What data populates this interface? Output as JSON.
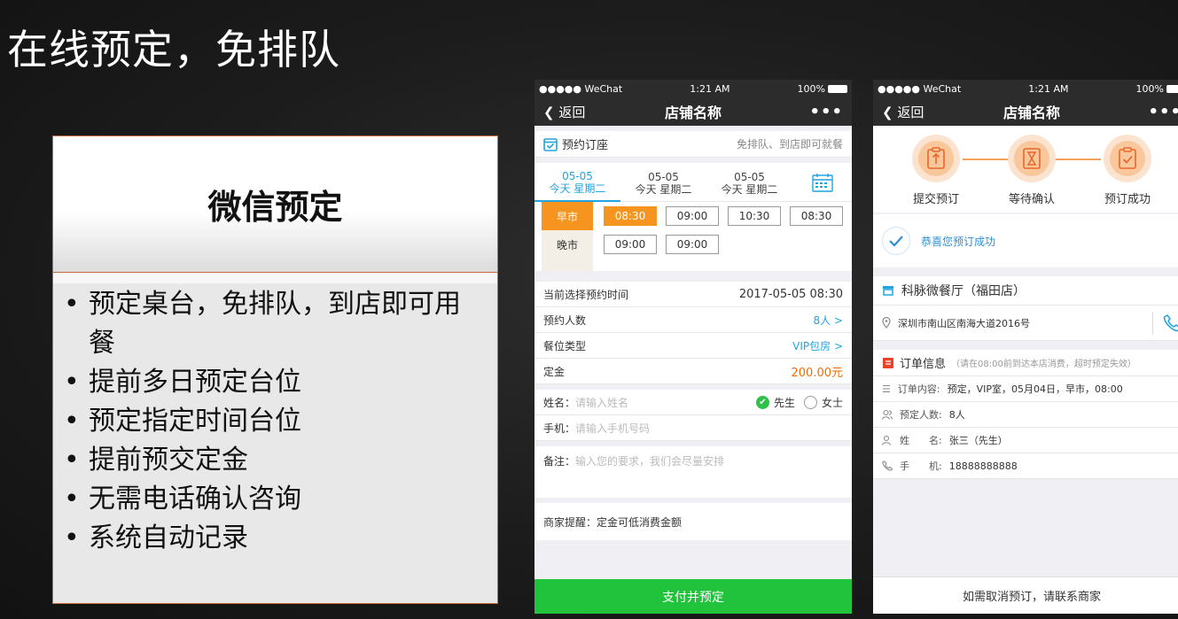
{
  "slide": {
    "title": "在线预定，免排队"
  },
  "card": {
    "heading": "微信预定",
    "bullets": [
      "预定桌台，免排队，到店即可用餐",
      "提前多日预定台位",
      "预定指定时间台位",
      "提前预交定金",
      "无需电话确认咨询",
      "系统自动记录"
    ]
  },
  "phone1": {
    "status": {
      "carrier": "●●●●● WeChat",
      "time": "1:21 AM",
      "battery": "100%"
    },
    "nav": {
      "back": "返回",
      "title": "店铺名称",
      "more": "•••"
    },
    "reservation": {
      "title": "预约订座",
      "subtitle": "免排队、到店即可就餐"
    },
    "dates": [
      {
        "date": "05-05",
        "day": "今天  星期二"
      },
      {
        "date": "05-05",
        "day": "今天  星期二"
      },
      {
        "date": "05-05",
        "day": "今天  星期二"
      }
    ],
    "meals": [
      {
        "label": "早市",
        "slots": [
          "08:30",
          "09:00",
          "10:30",
          "08:30"
        ]
      },
      {
        "label": "晚市",
        "slots": [
          "09:00",
          "09:00"
        ]
      }
    ],
    "info": {
      "time_label": "当前选择预约时间",
      "time_value": "2017-05-05  08:30",
      "people_label": "预约人数",
      "people_value": "8人  >",
      "seat_label": "餐位类型",
      "seat_value": "VIP包房  >",
      "deposit_label": "定金",
      "deposit_value": "200.00元"
    },
    "form": {
      "name_label": "姓名：",
      "name_placeholder": "请输入姓名",
      "mr": "先生",
      "ms": "女士",
      "phone_label": "手机：",
      "phone_placeholder": "请输入手机号码",
      "note_label": "备注：",
      "note_placeholder": "输入您的要求，我们会尽量安排"
    },
    "tip": "商家提醒：定金可低消费金额",
    "pay_button": "支付并预定"
  },
  "phone2": {
    "status": {
      "carrier": "●●●●● WeChat",
      "time": "1:21 AM",
      "battery": "100%"
    },
    "nav": {
      "back": "返回",
      "title": "店铺名称",
      "more": "•••"
    },
    "steps": [
      "提交预订",
      "等待确认",
      "预订成功"
    ],
    "success": "恭喜您预订成功",
    "shop": {
      "name": "科脉微餐厅（福田店）",
      "address": "深圳市南山区南海大道2016号"
    },
    "order": {
      "title": "订单信息",
      "subtitle": "（请在08:00前到达本店消费，超时预定失效）",
      "content_label": "订单内容:",
      "content_value": "预定，VIP室，05月04日，早市，08:00",
      "people_label": "预定人数:",
      "people_value": "8人",
      "name_label": "姓　　名:",
      "name_value": "张三（先生）",
      "phone_label": "手　　机:",
      "phone_value": "18888888888"
    },
    "contact": "如需取消预订，请联系商家"
  },
  "colors": {
    "accent_orange": "#f5941e",
    "accent_blue": "#22a4e0",
    "accent_green": "#22c33c",
    "dark_bar": "#2c2c2c"
  }
}
